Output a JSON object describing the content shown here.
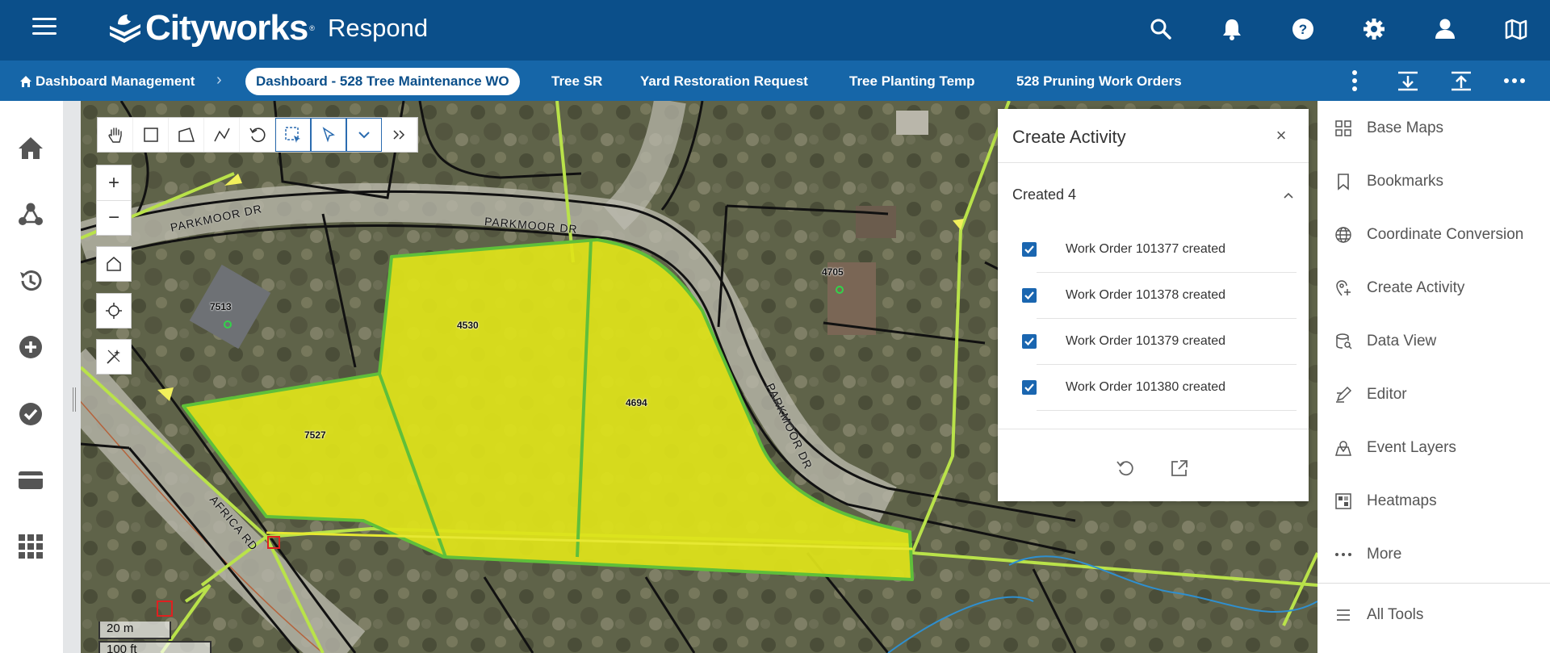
{
  "header": {
    "brand": "Cityworks",
    "brand_tm": "®",
    "app_name": "Respond",
    "icons": [
      "search-icon",
      "bell-icon",
      "help-icon",
      "gear-icon",
      "user-icon",
      "map-icon"
    ]
  },
  "tabbar": {
    "home_label": "Dashboard Management",
    "separator": "›",
    "tabs": [
      {
        "label": "Dashboard - 528 Tree Maintenance WO",
        "active": true
      },
      {
        "label": "Tree SR",
        "active": false
      },
      {
        "label": "Yard Restoration Request",
        "active": false
      },
      {
        "label": "Tree Planting Temp",
        "active": false
      },
      {
        "label": "528 Pruning Work Orders",
        "active": false
      }
    ],
    "tools": [
      "vertical-more-icon",
      "collapse-down-icon",
      "expand-up-icon",
      "horizontal-more-icon"
    ]
  },
  "left_sidebar": {
    "items": [
      "home-icon",
      "network-icon",
      "history-icon",
      "add-circle-icon",
      "check-circle-icon",
      "card-icon",
      "apps-grid-icon"
    ]
  },
  "map": {
    "zoom_in": "+",
    "zoom_out": "−",
    "parcel_labels": [
      "4530",
      "4694",
      "7527",
      "7513",
      "4705"
    ],
    "road_labels": [
      "PARKMOOR DR",
      "PARKMOOR DR",
      "PARKMOOR DR",
      "AFRICA RD"
    ],
    "scale_metric": "20 m",
    "scale_imperial": "100 ft",
    "toolbar": [
      "pan-hand-icon",
      "rectangle-icon",
      "polygon-icon",
      "polyline-icon",
      "reset-icon",
      "select-box-icon",
      "select-pointer-icon",
      "dropdown-icon",
      "expand-icon"
    ]
  },
  "create_activity": {
    "title": "Create Activity",
    "close": "×",
    "section": "Created 4",
    "items": [
      {
        "label": "Work Order 101377 created",
        "checked": true
      },
      {
        "label": "Work Order 101378 created",
        "checked": true
      },
      {
        "label": "Work Order 101379 created",
        "checked": true
      },
      {
        "label": "Work Order 101380 created",
        "checked": true
      }
    ]
  },
  "right_tools": {
    "items": [
      {
        "label": "Base Maps",
        "icon": "basemaps-icon"
      },
      {
        "label": "Bookmarks",
        "icon": "bookmark-icon"
      },
      {
        "label": "Coordinate Conversion",
        "icon": "globe-icon"
      },
      {
        "label": "Create Activity",
        "icon": "create-activity-icon"
      },
      {
        "label": "Data View",
        "icon": "data-view-icon"
      },
      {
        "label": "Editor",
        "icon": "editor-icon"
      },
      {
        "label": "Event Layers",
        "icon": "event-layers-icon"
      },
      {
        "label": "Heatmaps",
        "icon": "heatmap-icon"
      },
      {
        "label": "More",
        "icon": "more-dots-icon"
      }
    ],
    "all_tools": "All Tools"
  },
  "colors": {
    "header": "#0b4f8a",
    "tabbar": "#1666a8",
    "parcel_fill": "#dfe31a",
    "parcel_outline": "#5fbf3a",
    "checkbox": "#1a66b0"
  }
}
